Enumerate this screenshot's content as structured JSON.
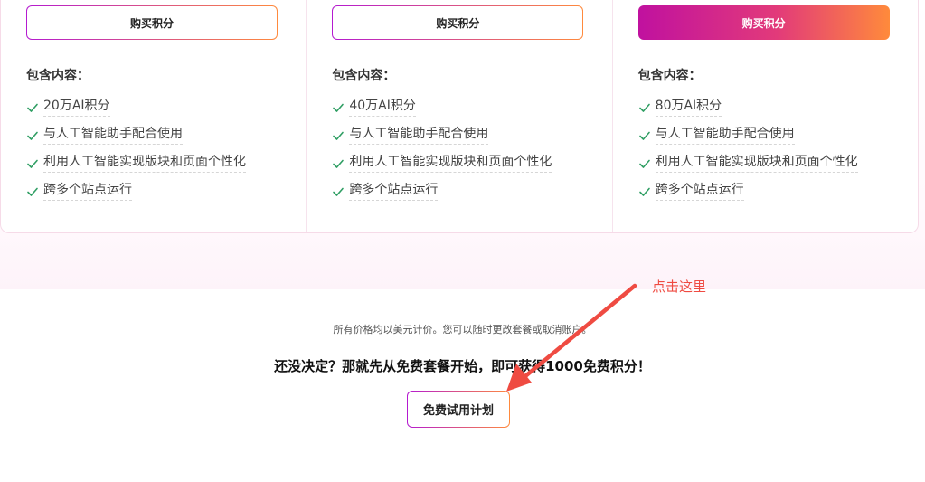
{
  "plans": [
    {
      "buy_label": "购买积分",
      "style": "outline",
      "includes_title": "包含内容：",
      "features": [
        "20万AI积分",
        "与人工智能助手配合使用",
        "利用人工智能实现版块和页面个性化",
        "跨多个站点运行"
      ]
    },
    {
      "buy_label": "购买积分",
      "style": "outline",
      "includes_title": "包含内容：",
      "features": [
        "40万AI积分",
        "与人工智能助手配合使用",
        "利用人工智能实现版块和页面个性化",
        "跨多个站点运行"
      ]
    },
    {
      "buy_label": "购买积分",
      "style": "filled",
      "includes_title": "包含内容：",
      "features": [
        "80万AI积分",
        "与人工智能助手配合使用",
        "利用人工智能实现版块和页面个性化",
        "跨多个站点运行"
      ]
    }
  ],
  "footer": {
    "price_note": "所有价格均以美元计价。您可以随时更改套餐或取消账户。",
    "headline": "还没决定？那就先从免费套餐开始，即可获得1000免费积分！",
    "free_button": "免费试用计划"
  },
  "annotation": {
    "text": "点击这里",
    "color": "#ef4b42"
  },
  "colors": {
    "check": "#2f9e63",
    "gradient_start": "#c0119f",
    "gradient_end": "#ff8a3b"
  },
  "icons": {
    "check": "check-icon",
    "arrow": "arrow-icon"
  }
}
